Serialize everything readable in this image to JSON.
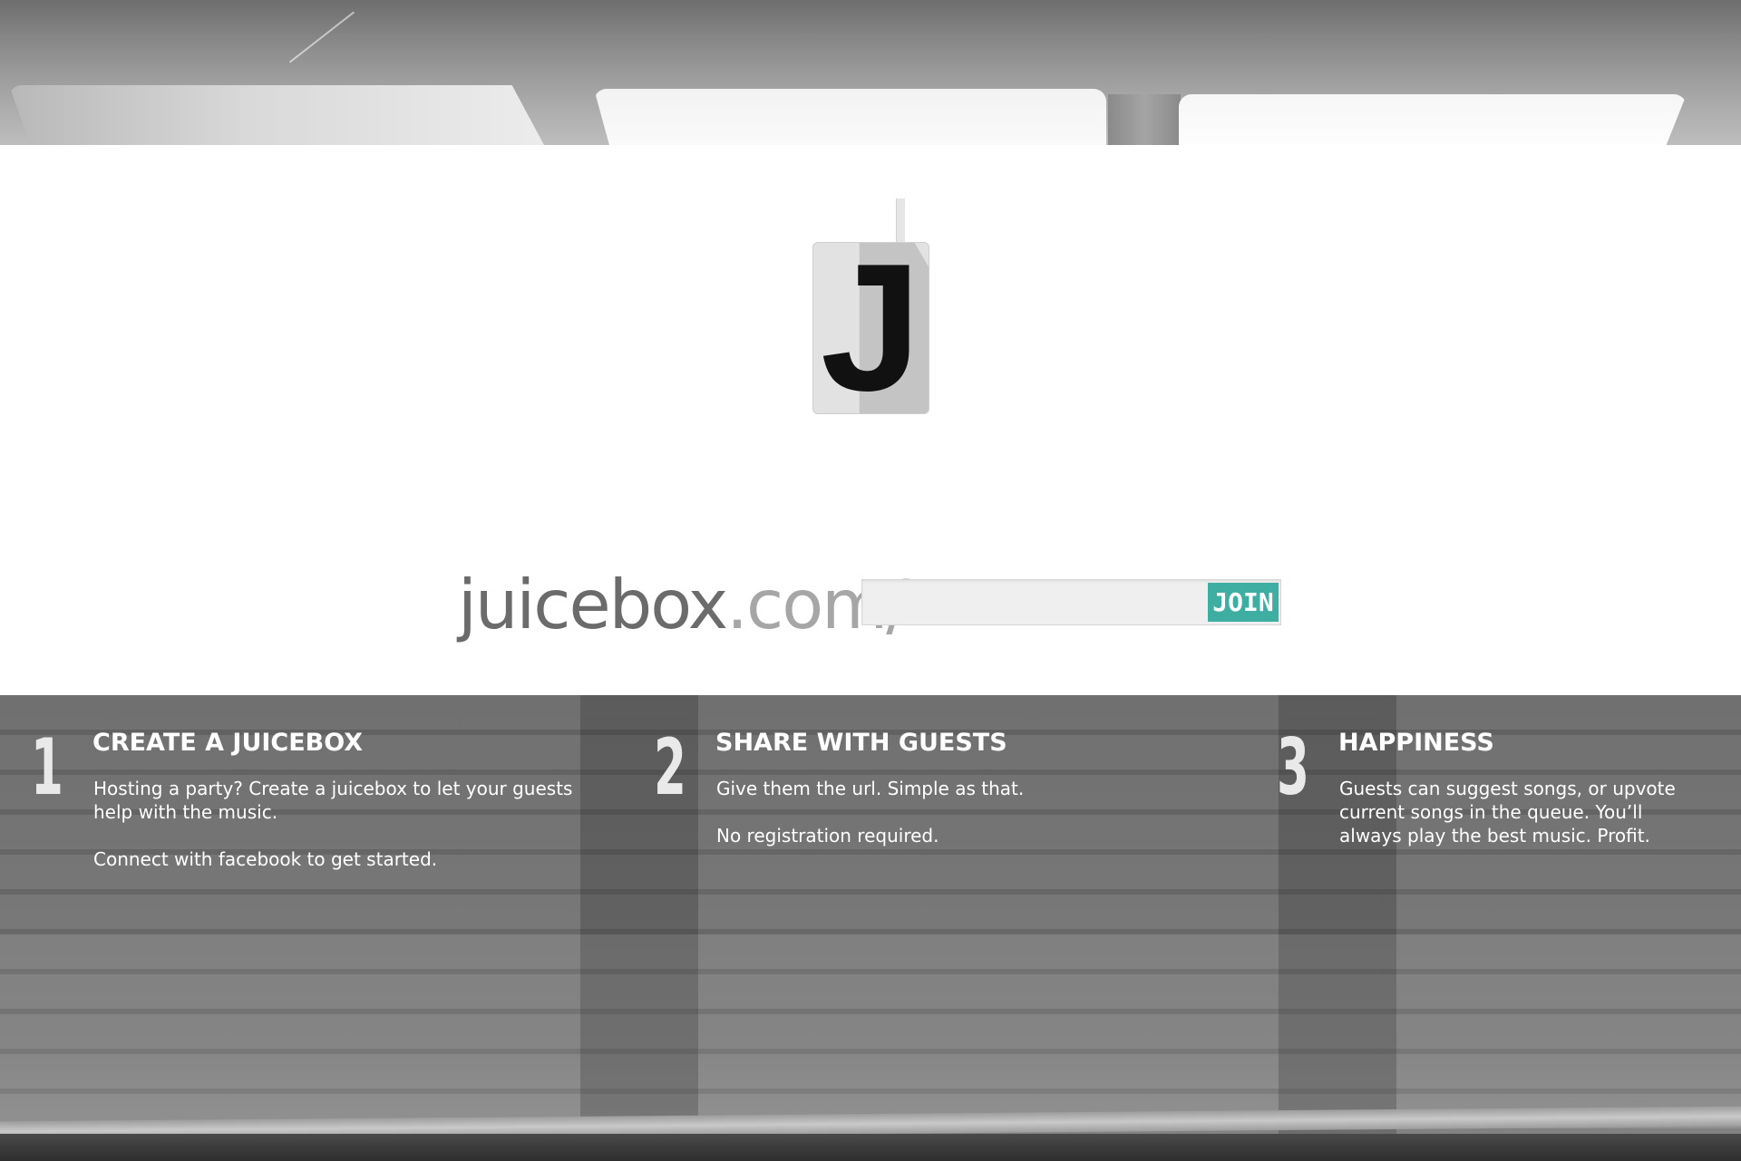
{
  "logo": {
    "letter": "J"
  },
  "join": {
    "url_domain": "juicebox",
    "url_tld": ".com/",
    "input_value": "",
    "input_placeholder": "",
    "button_label": "JOIN",
    "button_color": "#3eaea2"
  },
  "steps": [
    {
      "number": "1",
      "title": "CREATE A JUICEBOX",
      "body": [
        "Hosting a party?  Create a juicebox to let your guests help with the music.",
        "Connect with facebook to get started."
      ]
    },
    {
      "number": "2",
      "title": "SHARE WITH GUESTS",
      "body": [
        "Give them the url.  Simple as that.",
        "No registration required."
      ]
    },
    {
      "number": "3",
      "title": "HAPPINESS",
      "body": [
        "Guests can suggest songs, or upvote current songs in the queue.  You’ll always play the best music.  Profit."
      ]
    }
  ]
}
